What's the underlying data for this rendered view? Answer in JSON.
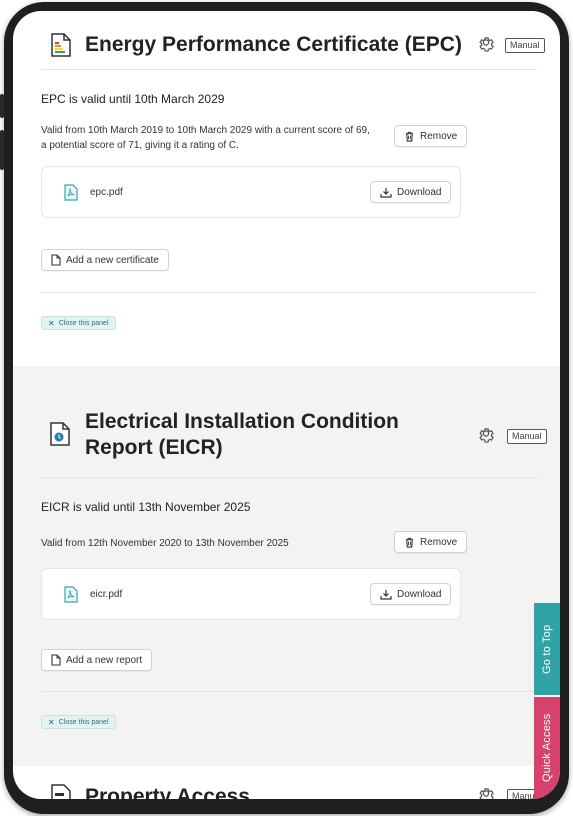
{
  "epc": {
    "title": "Energy Performance Certificate (EPC)",
    "manual_label": "Manual",
    "valid_summary": "EPC is valid until 10th March 2029",
    "details": "Valid from 10th March 2019 to 10th March 2029 with a current score of 69, a potential score of 71, giving it a rating of C.",
    "remove_label": "Remove",
    "file_name": "epc.pdf",
    "download_label": "Download",
    "add_label": "Add a new certificate",
    "close_label": "Close this panel"
  },
  "eicr": {
    "title": "Electrical Installation Condition Report (EICR)",
    "manual_label": "Manual",
    "valid_summary": "EICR is valid until 13th November 2025",
    "details": "Valid from 12th November 2020 to 13th November 2025",
    "remove_label": "Remove",
    "file_name": "eicr.pdf",
    "download_label": "Download",
    "add_label": "Add a new report",
    "close_label": "Close this panel"
  },
  "property_access": {
    "title": "Property Access",
    "manual_label": "Manual"
  },
  "side_tabs": {
    "go_to_top": "Go to Top",
    "quick_access": "Quick Access"
  },
  "colors": {
    "go_to_top": "#2fa3a5",
    "quick_access": "#d6426d",
    "close_panel_text": "#2f6c76"
  }
}
